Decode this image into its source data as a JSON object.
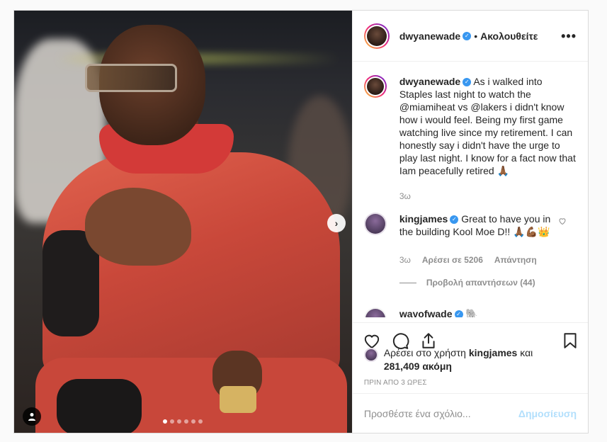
{
  "post": {
    "username": "dwyanewade",
    "separator": "•",
    "follow_label": "Ακολουθείτε",
    "more_label": "•••",
    "carousel_dots": 6,
    "active_dot": 0
  },
  "caption": {
    "username": "dwyanewade",
    "text": "As i walked into Staples last night to watch the @miamiheat vs @lakers i didn't know how i would feel. Being my first game watching live since my retirement. I can honestly say i didn't have the urge to play last night. I know for a fact now that Iam peacefully retired 🙏🏾",
    "time": "3ω"
  },
  "comments": [
    {
      "username": "kingjames",
      "text": "Great to have you in the building Kool Moe D!! 🙏🏾💪🏾👑",
      "time": "3ω",
      "likes": "Αρέσει σε 5206",
      "reply_label": "Απάντηση",
      "view_replies": "Προβολή απαντήσεων (44)"
    },
    {
      "username": "wayofwade",
      "text": "🐘"
    }
  ],
  "likes": {
    "prefix": "Αρέσει στο χρήστη",
    "user": "kingjames",
    "middle": "και",
    "count": "281,409 ακόμη"
  },
  "timeago": "ΠΡΙΝ ΑΠΟ 3 ΩΡΕΣ",
  "add_comment": {
    "placeholder": "Προσθέστε ένα σχόλιο...",
    "post_label": "Δημοσίευση"
  },
  "colors": {
    "verified": "#3897f0",
    "muted": "#8e8e8e",
    "post_disabled": "#b2dffc"
  }
}
